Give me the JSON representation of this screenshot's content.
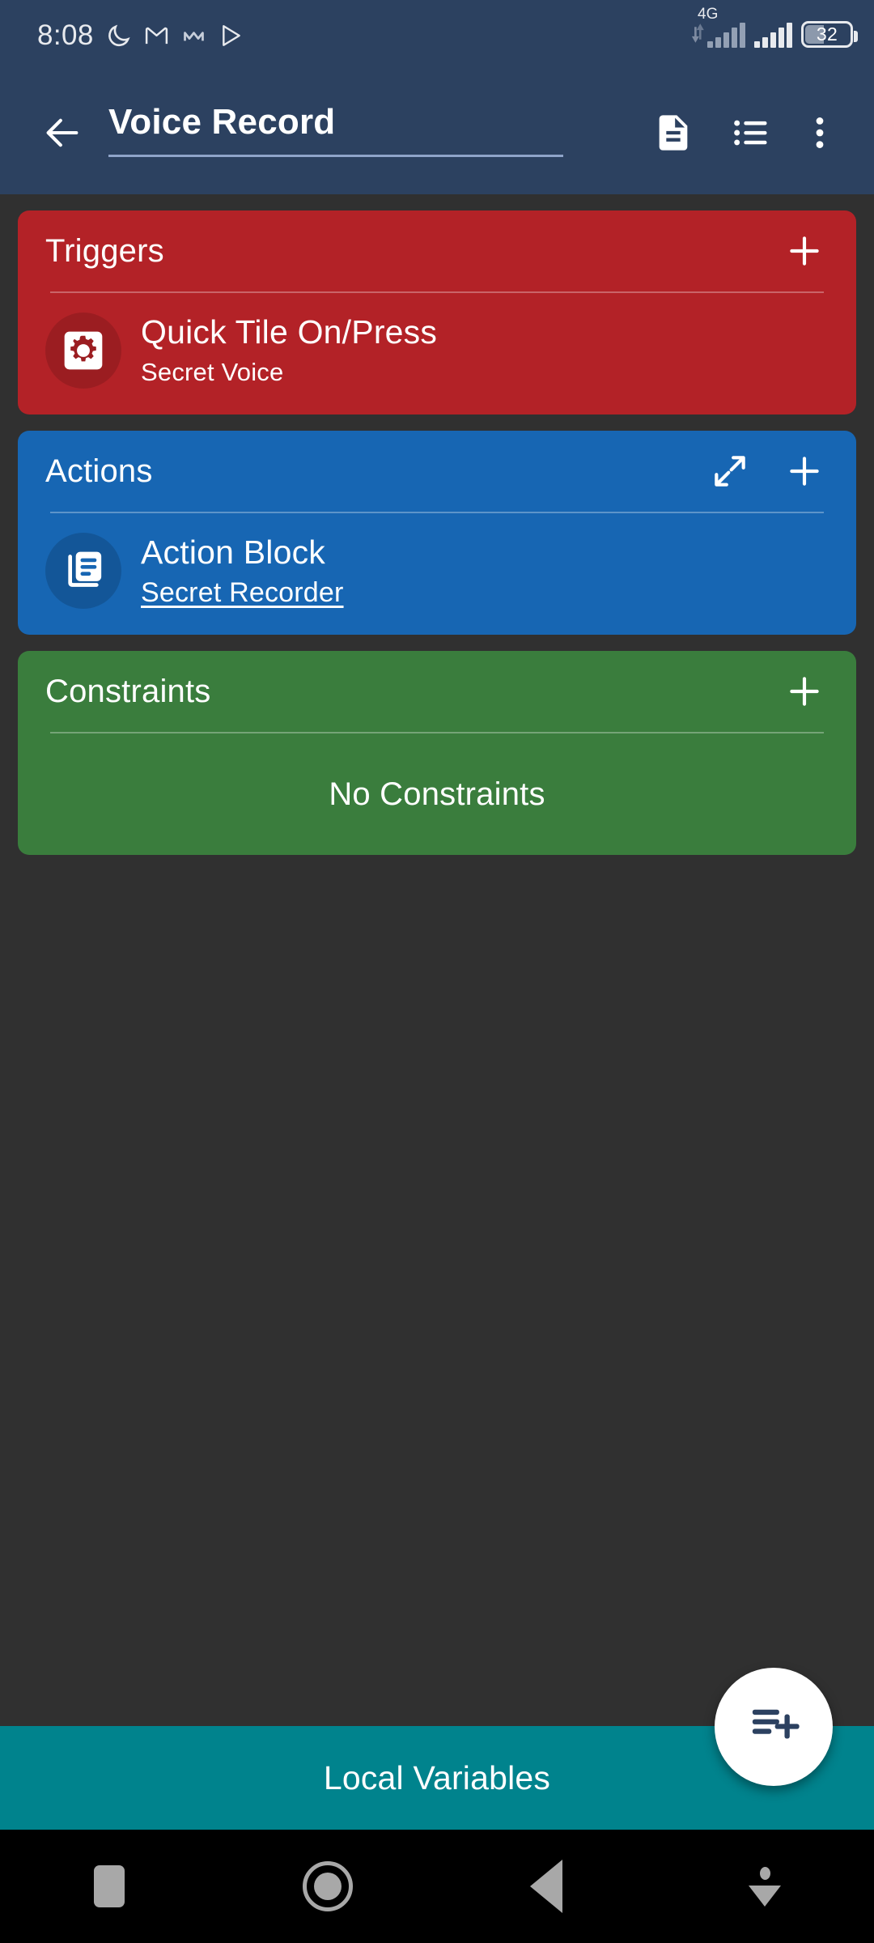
{
  "status_bar": {
    "time": "8:08",
    "icons": [
      "moon-dnd-icon",
      "gmail-icon",
      "monero-icon",
      "play-store-icon"
    ],
    "network_label": "4G",
    "battery_level": "32"
  },
  "app_bar": {
    "back_icon": "arrow-back-icon",
    "title": "Voice Record",
    "actions": [
      "description-icon",
      "list-icon",
      "overflow-menu-icon"
    ]
  },
  "cards": {
    "triggers": {
      "title": "Triggers",
      "color": "#B32227",
      "add_icon": "plus-icon",
      "items": [
        {
          "icon": "quick-tile-icon",
          "title": "Quick Tile On/Press",
          "subtitle": "Secret Voice"
        }
      ]
    },
    "actions": {
      "title": "Actions",
      "color": "#1766B3",
      "expand_icon": "expand-icon",
      "add_icon": "plus-icon",
      "items": [
        {
          "icon": "action-block-icon",
          "title": "Action Block",
          "subtitle": "Secret Recorder"
        }
      ]
    },
    "constraints": {
      "title": "Constraints",
      "color": "#3A7D3D",
      "add_icon": "plus-icon",
      "empty_text": "No Constraints",
      "items": []
    }
  },
  "bottom": {
    "local_variables_label": "Local Variables",
    "local_variables_color": "#00838D",
    "fab_icon": "playlist-add-icon"
  },
  "nav_bar": {
    "buttons": [
      "recents-square-icon",
      "home-circle-icon",
      "back-triangle-icon",
      "hide-keyboard-icon"
    ]
  }
}
